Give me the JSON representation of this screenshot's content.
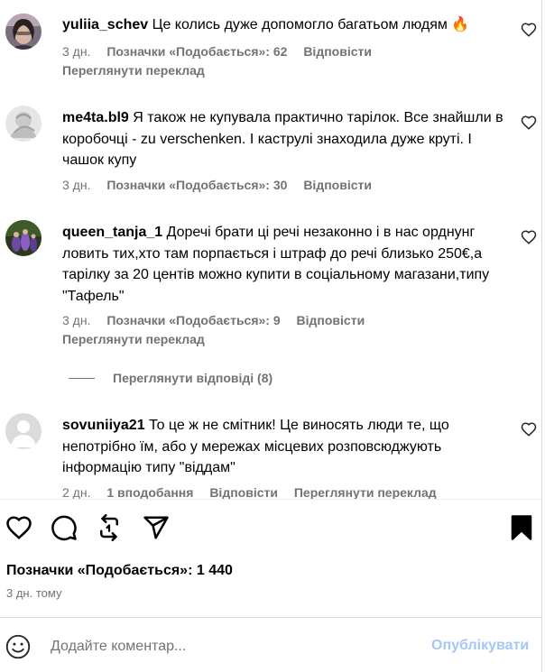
{
  "comments": [
    {
      "username": "yuliia_schev",
      "text": "Це колись дуже допомогло багатьом людям 🔥",
      "time": "3 дн.",
      "likes": "Позначки «Подобається»: 62",
      "reply": "Відповісти",
      "translate": "Переглянути переклад"
    },
    {
      "username": "me4ta.bl9",
      "text": "Я також не купувала практично тарілок. Все знайшли в коробочці - zu verschenken. І каструлі знаходила дуже круті. І чашок купу",
      "time": "3 дн.",
      "likes": "Позначки «Подобається»: 30",
      "reply": "Відповісти"
    },
    {
      "username": "queen_tanja_1",
      "text": "Доречі брати ці речі незаконно і в нас орднунг ловить тих,хто там порпається і штраф до речі близько 250€,а тарілку за 20 центів можно купити в соціальному магазани,типу \"Тафель\"",
      "time": "3 дн.",
      "likes": "Позначки «Подобається»: 9",
      "reply": "Відповісти",
      "translate": "Переглянути переклад",
      "view_replies": "Переглянути відповіді (8)"
    },
    {
      "username": "sovuniiya21",
      "text": "То це ж не смітник! Це виносять люди те, що непотрібно їм, або у мережах місцевих розповсюджують інформацію типу \"віддам\"",
      "time": "2 дн.",
      "likes": "1 вподобання",
      "reply": "Відповісти",
      "translate": "Переглянути переклад"
    }
  ],
  "actions": {
    "like_icon": "heart-outline",
    "comment_icon": "speech-bubble",
    "repost_icon": "repost-arrows",
    "share_icon": "paper-plane",
    "save_icon": "bookmark-filled"
  },
  "post": {
    "likes": "Позначки «Подобається»: 1 440",
    "time": "3 дн. тому"
  },
  "add_comment": {
    "placeholder": "Додайте коментар...",
    "publish": "Опублікувати"
  },
  "colors": {
    "secondary_text": "#737373",
    "publish_disabled": "#a3c8f6",
    "border": "#dbdbdb"
  }
}
